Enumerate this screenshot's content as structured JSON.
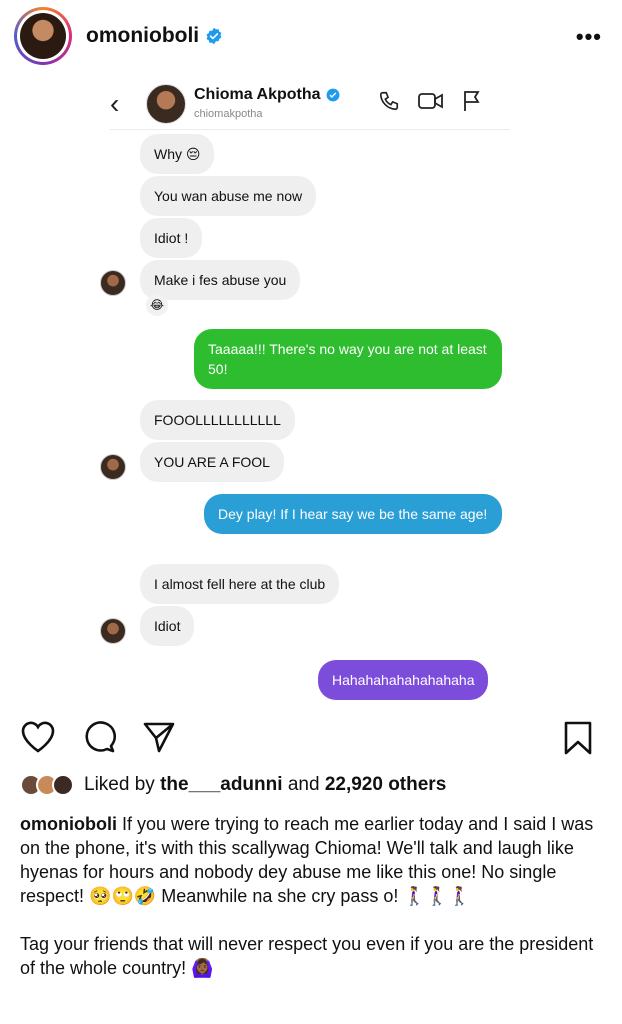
{
  "post": {
    "username": "omonioboli",
    "more": "•••"
  },
  "dm": {
    "contact_name": "Chioma Akpotha",
    "contact_handle": "chiomakpotha",
    "messages": [
      {
        "side": "left",
        "text": "Why 😔"
      },
      {
        "side": "left",
        "text": "You wan abuse me now"
      },
      {
        "side": "left",
        "text": "Idiot !"
      },
      {
        "side": "left",
        "text": "Make i fes abuse you"
      },
      {
        "side": "right",
        "text": "Taaaaa!!! There's no way you are not at least 50!",
        "color": "#2ebd2e"
      },
      {
        "side": "left",
        "text": "FOOOLLLLLLLLLLL"
      },
      {
        "side": "left",
        "text": "YOU ARE A FOOL"
      },
      {
        "side": "right",
        "text": "Dey play! If I hear say we be the same age!",
        "color": "#2a9fd6"
      },
      {
        "side": "left",
        "text": "I almost fell here at the club"
      },
      {
        "side": "left",
        "text": "Idiot"
      },
      {
        "side": "right",
        "text": "Hahahahahahahahaha",
        "color": "#7c4ddb"
      }
    ],
    "reaction": "😂"
  },
  "likes": {
    "prefix": "Liked by",
    "user": "the___adunni",
    "and": "and",
    "count": "22,920 others"
  },
  "caption": {
    "username": "omonioboli",
    "text1": "If you were trying to reach me earlier today and I said I was on the phone, it's with this scallywag Chioma! We'll talk and laugh like hyenas for hours and nobody dey abuse me like this one! No single respect! 🥺🙄🤣 Meanwhile na she cry pass o! 🚶‍♀️🚶‍♀️🚶‍♀️",
    "text2": "Tag your friends that will never respect you even if you are the president of the whole country! 🙆🏾‍♀️"
  }
}
